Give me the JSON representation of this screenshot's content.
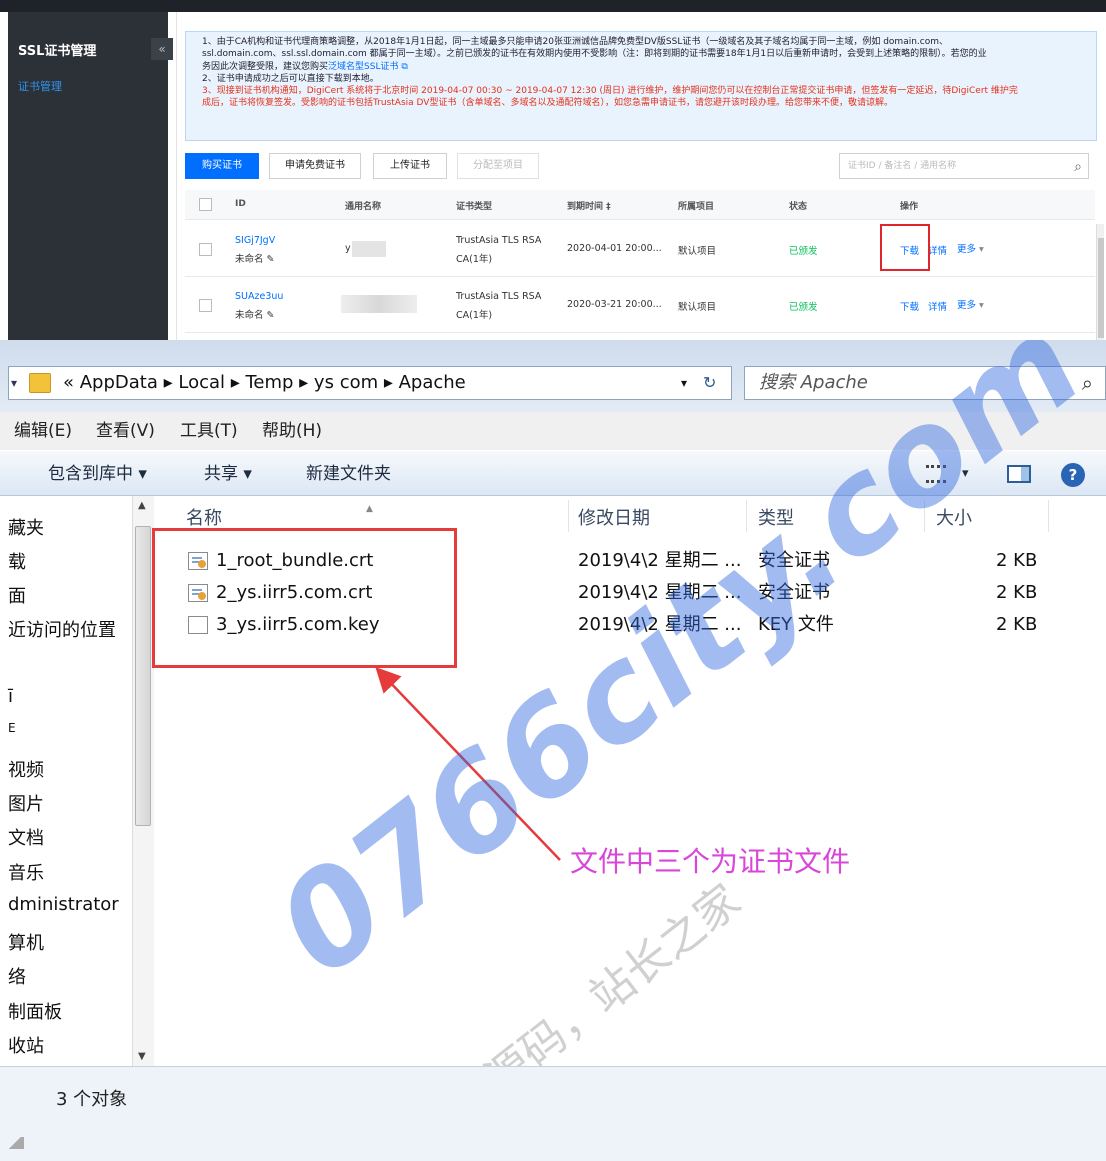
{
  "console": {
    "sidebar": {
      "title": "SSL证书管理",
      "collapse": "«",
      "nav_item": "证书管理"
    },
    "notice": {
      "line1": "1、由于CA机构和证书代理商策略调整，从2018年1月1日起，同一主域最多只能申请20张亚洲诚信品牌免费型DV版SSL证书（一级域名及其子域名均属于同一主域，例如 domain.com、",
      "line2": "ssl.domain.com、ssl.ssl.domain.com 都属于同一主域）。之前已颁发的证书在有效期内使用不受影响（注：即将到期的证书需要18年1月1日以后重新申请时，会受到上述策略的限制）。若您的业",
      "line3": "务因此次调整受限，建议您购买",
      "line3_link": "泛域名型SSL证书",
      "line4": "2、证书申请成功之后可以直接下载到本地。",
      "line5": "3、现接到证书机构通知，DigiCert 系统将于北京时间 2019-04-07 00:30 ~ 2019-04-07 12:30 (周日) 进行维护，维护期间您仍可以在控制台正常提交证书申请，但签发有一定延迟，待DigiCert 维护完",
      "line6": "成后，证书将恢复签发。受影响的证书包括TrustAsia DV型证书（含单域名、多域名以及通配符域名），如您急需申请证书，请您避开该时段办理。给您带来不便，敬请谅解。"
    },
    "toolbar": {
      "buy": "购买证书",
      "apply_free": "申请免费证书",
      "upload": "上传证书",
      "assign": "分配至项目",
      "search_placeholder": "证书ID / 备注名 / 通用名称"
    },
    "table": {
      "headers": [
        "ID",
        "通用名称",
        "证书类型",
        "到期时间 ‡",
        "所属项目",
        "状态",
        "操作"
      ],
      "rows": [
        {
          "id": "SIGj7JgV",
          "alias": "未命名",
          "common_name": "y      .com",
          "type_line1": "TrustAsia TLS RSA",
          "type_line2": "CA(1年)",
          "expire": "2020-04-01 20:00...",
          "project": "默认项目",
          "status": "已颁发",
          "download": "下载",
          "detail": "详情",
          "more": "更多"
        },
        {
          "id": "SUAze3uu",
          "alias": "未命名",
          "common_name": "",
          "type_line1": "TrustAsia TLS RSA",
          "type_line2": "CA(1年)",
          "expire": "2020-03-21 20:00...",
          "project": "默认项目",
          "status": "已颁发",
          "download": "下载",
          "detail": "详情",
          "more": "更多"
        }
      ]
    }
  },
  "explorer": {
    "address": {
      "crumbs": "«  AppData  ▸  Local  ▸  Temp  ▸  ys          com  ▸  Apache",
      "dropdown": "▾",
      "refresh": "↻",
      "search_placeholder": "搜索 Apache",
      "search_icon": "⌕"
    },
    "menu": [
      "编辑(E)",
      "查看(V)",
      "工具(T)",
      "帮助(H)"
    ],
    "commands": {
      "include": "包含到库中 ▾",
      "share": "共享 ▾",
      "new_folder": "新建文件夹",
      "view_dd": "▾",
      "help": "?"
    },
    "nav_items": [
      "藏夹",
      "下载",
      "桌面",
      "最近访问的位置",
      "库",
      "库",
      "视频",
      "图片",
      "文档",
      "音乐",
      "dministrator",
      "计算机",
      "网络",
      "控制面板",
      "回收站"
    ],
    "nav_labels_visible": [
      "藏夹",
      "载",
      "面",
      "近访问的位置",
      "",
      "",
      "视频",
      "图片",
      "文档",
      "音乐",
      "dministrator",
      "算机",
      "络",
      "制面板",
      "收站"
    ],
    "columns": {
      "name": "名称",
      "modified": "修改日期",
      "type": "类型",
      "size": "大小"
    },
    "files": [
      {
        "name": "1_root_bundle.crt",
        "modified": "2019\\4\\2 星期二 ...",
        "type": "安全证书",
        "size": "2 KB",
        "icon": "cert-icon"
      },
      {
        "name": "2_ys.iirr5.com.crt",
        "modified": "2019\\4\\2 星期二 ...",
        "type": "安全证书",
        "size": "2 KB",
        "icon": "cert-icon"
      },
      {
        "name": "3_ys.iirr5.com.key",
        "modified": "2019\\4\\2 星期二 ...",
        "type": "KEY 文件",
        "size": "2 KB",
        "icon": "file-icon"
      }
    ],
    "annotation": "文件中三个为证书文件",
    "status": "3 个对象"
  },
  "watermark": {
    "main": "0766city.com",
    "sub": "商业源码，站长之家"
  },
  "colors": {
    "accent": "#006eff",
    "highlight": "#e53b3b",
    "annotation": "#d946d9",
    "issued": "#0abf5b"
  }
}
